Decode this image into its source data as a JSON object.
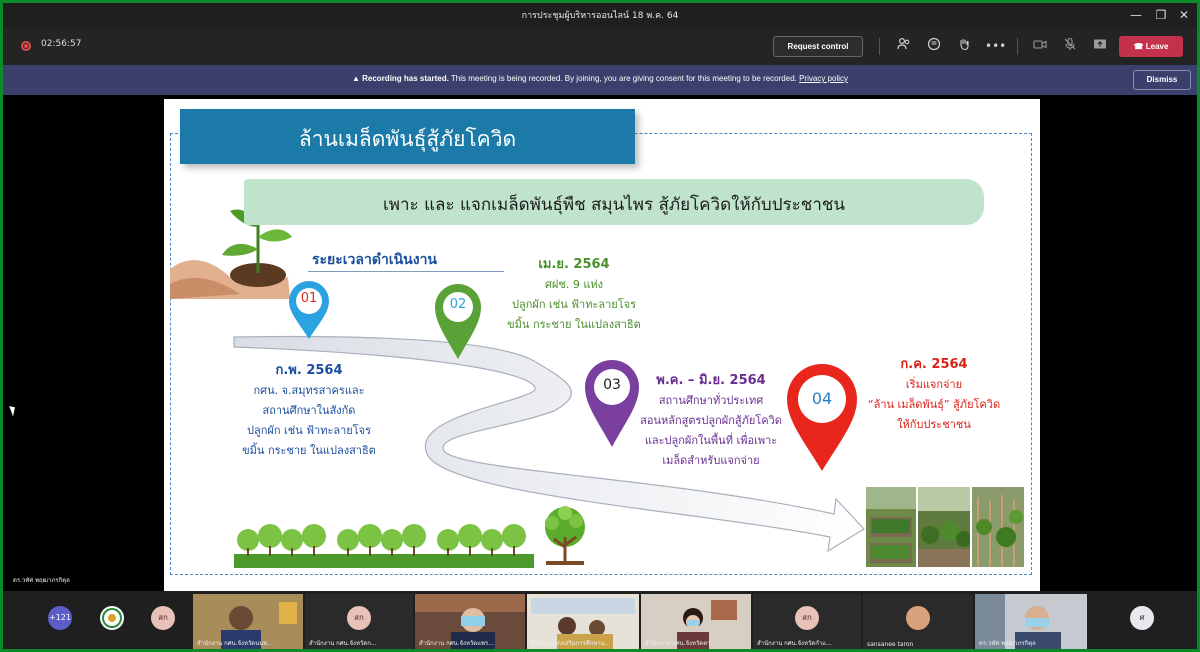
{
  "window": {
    "title": "การประชุมผู้บริหารออนไลน์ 18 พ.ค. 64",
    "minimize": "—",
    "restore": "❐",
    "close": "✕"
  },
  "toolbar": {
    "timer": "02:56:57",
    "request_control": "Request control",
    "leave": "Leave",
    "more": "•••"
  },
  "banner": {
    "bold": "Recording has started.",
    "text": "This meeting is being recorded. By joining, you are giving consent for this meeting to be recorded.",
    "link": "Privacy policy",
    "dismiss": "Dismiss"
  },
  "slide": {
    "title": "ล้านเมล็ดพันธุ์สู้ภัยโควิด",
    "subtitle": "เพาะ และ แจกเมล็ดพันธุ์พืช สมุนไพร สู้ภัยโควิดให้กับประชาชน",
    "timeline_heading": "ระยะเวลาดำเนินงาน",
    "steps": [
      {
        "num": "01",
        "color": "#2aa3e0",
        "head": "ก.พ. 2564",
        "lines": [
          "กศน. จ.สมุทรสาครและ",
          "สถานศึกษาในสังกัด",
          "ปลูกผัก เช่น ฟ้าทะลายโจร",
          "ขมิ้น กระชาย ในแปลงสาธิต"
        ]
      },
      {
        "num": "02",
        "color": "#5aa238",
        "head": "เม.ย. 2564",
        "lines": [
          "ศฝช. 9 แห่ง",
          "ปลูกผัก เช่น ฟ้าทะลายโจร",
          "ขมิ้น กระชาย ในแปลงสาธิต"
        ]
      },
      {
        "num": "03",
        "color": "#7b3fa0",
        "head": "พ.ค. – มิ.ย. 2564",
        "lines": [
          "สถานศึกษาทั่วประเทศ",
          "สอนหลักสูตรปลูกผักสู้ภัยโควิด",
          "และปลูกผักในพื้นที่ เพื่อเพาะ",
          "เมล็ดสำหรับแจกจ่าย"
        ]
      },
      {
        "num": "04",
        "color": "#e8261c",
        "head": "ก.ค. 2564",
        "lines": [
          "เริ่มแจกจ่าย",
          "“ล้าน เมล็ดพันธุ์” สู้ภัยโควิด",
          "ให้กับประชาชน"
        ]
      }
    ]
  },
  "stage": {
    "presenter_name": "ดร.วทัศ พฤฒาภรกิตุล"
  },
  "participants": {
    "count": "+121",
    "tiles": [
      {
        "name": "สำนักงาน กศน.จังหวัดนนท...",
        "initials": ""
      },
      {
        "name": "สำนักงาน กศน.จังหวัดก...",
        "initials": "สก"
      },
      {
        "name": "สำนักงาน กศน.จังหวัดแพร...",
        "initials": ""
      },
      {
        "name": "สำนักงานส่งเสริมการศึกษาน...",
        "initials": ""
      },
      {
        "name": "สำนักงาน กศน.จังหวัดตา...",
        "initials": ""
      },
      {
        "name": "สำนักงาน กศน.จังหวัดกำแ...",
        "initials": "สก"
      },
      {
        "name": "sansanee taron",
        "initials": ""
      },
      {
        "name": "ดร.วทัศ พฤฒาภรกิตุล",
        "initials": ""
      }
    ],
    "avatar_1": "สก",
    "avatar_last": "ศ"
  }
}
